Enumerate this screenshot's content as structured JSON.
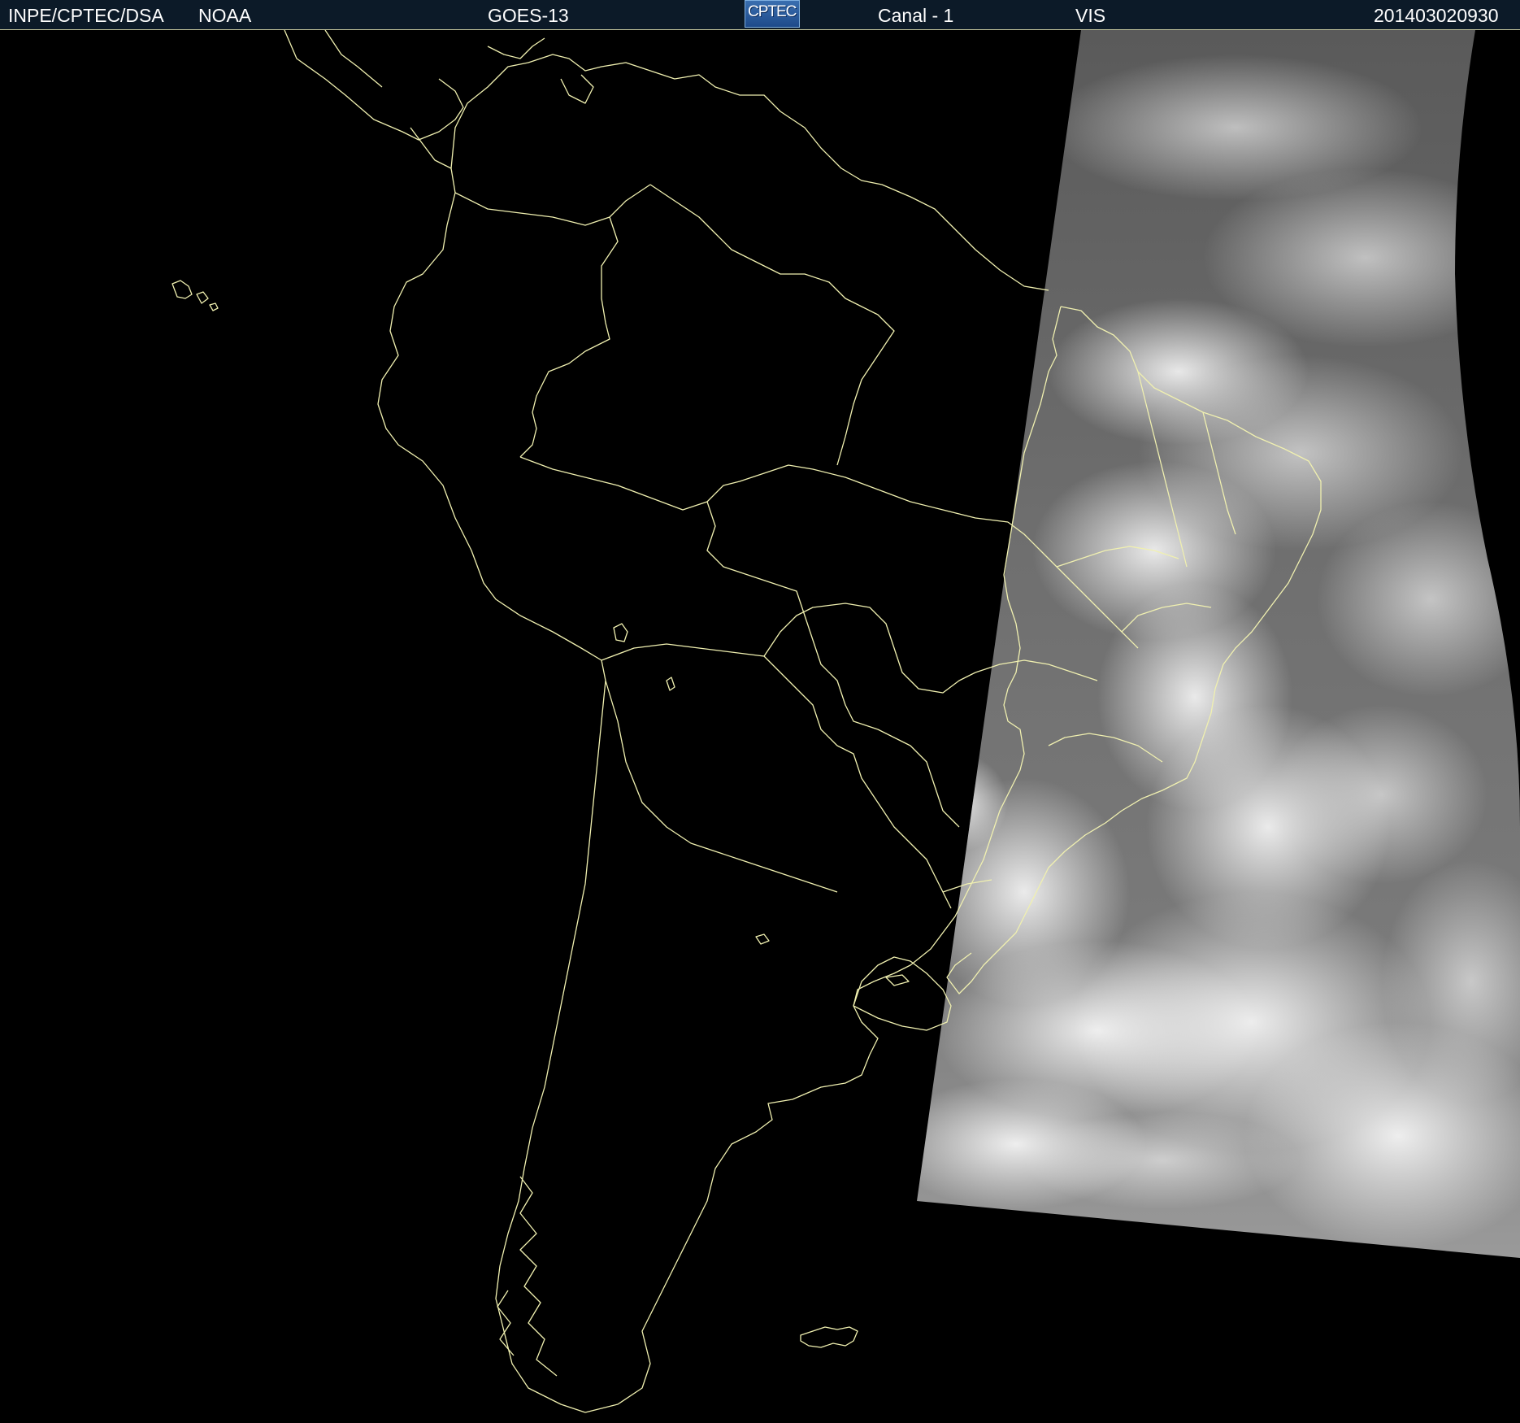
{
  "header": {
    "agency": "INPE/CPTEC/DSA",
    "provider": "NOAA",
    "satellite": "GOES-13",
    "logo_text": "CPTEC",
    "channel": "Canal - 1",
    "band": "VIS",
    "timestamp": "201403020930"
  },
  "map": {
    "boundary_color": "#f0f0b0",
    "background_color": "#000000"
  }
}
